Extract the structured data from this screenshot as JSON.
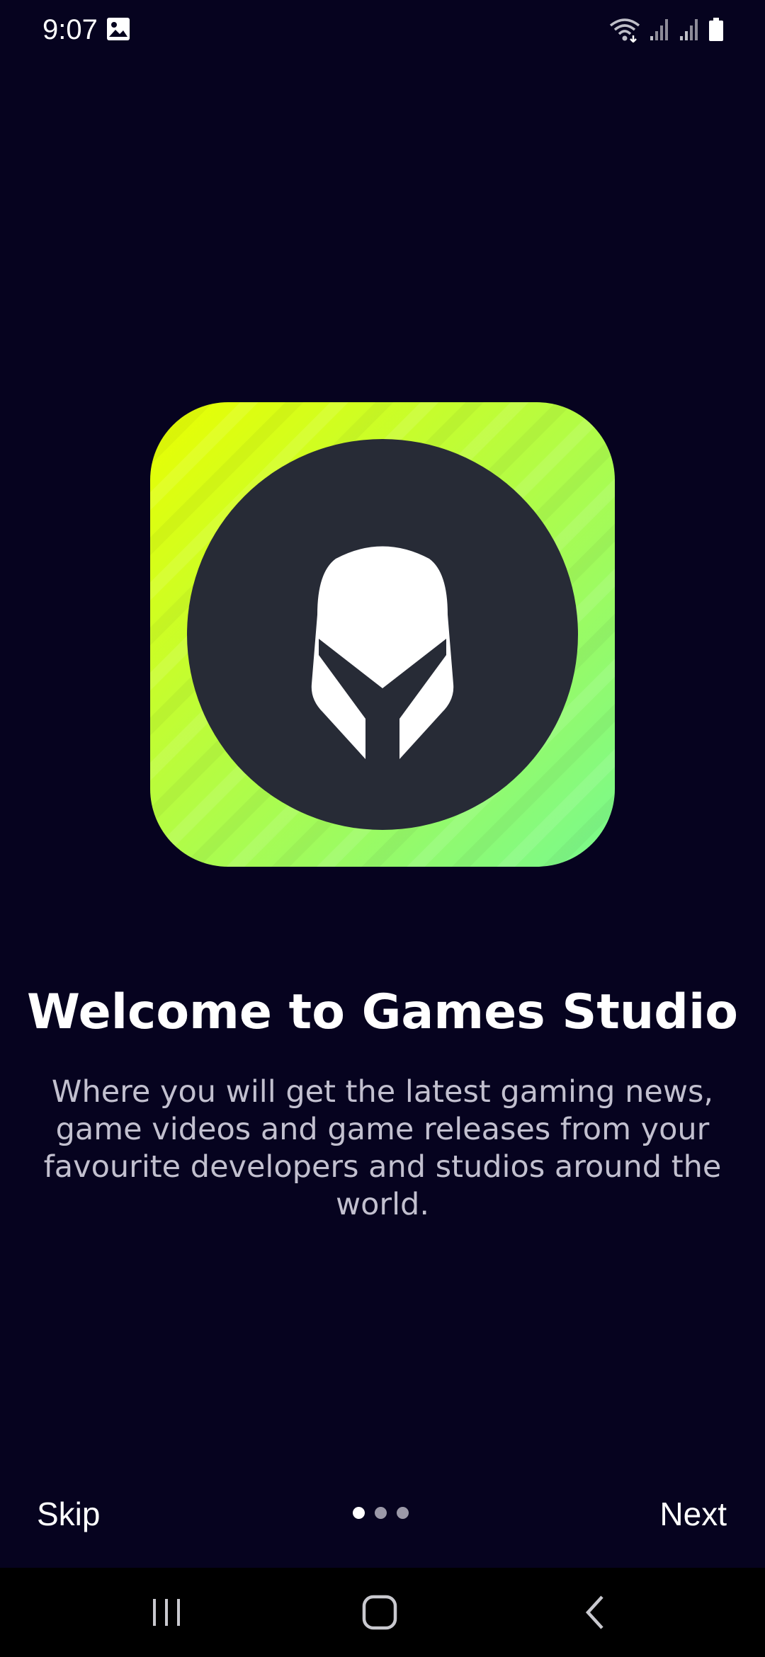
{
  "status_bar": {
    "time": "9:07",
    "left_icons": [
      "gallery-icon"
    ],
    "right_icons": [
      "wifi-icon",
      "signal-icon",
      "signal-icon",
      "battery-icon"
    ]
  },
  "logo": {
    "icon": "helmet-logo-icon",
    "gradient_start": "#e8ff00",
    "gradient_end": "#7cf98a",
    "circle_color": "#272b36"
  },
  "onboarding": {
    "title": "Welcome to Games Studio",
    "description": "Where you will get the latest gaming news, game videos and game releases from your favourite developers and studios around the world.",
    "skip_label": "Skip",
    "next_label": "Next",
    "page_count": 3,
    "current_page": 1
  },
  "nav_bar": {
    "icons": [
      "recent-apps-icon",
      "home-icon",
      "back-icon"
    ]
  },
  "colors": {
    "background": "#06031f",
    "text_primary": "#ffffff",
    "text_secondary": "#c2c0cf"
  }
}
